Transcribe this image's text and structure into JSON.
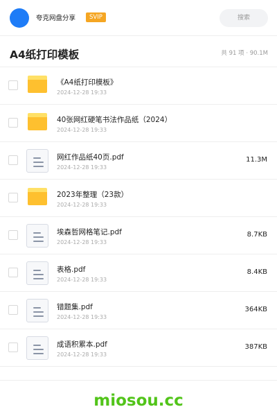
{
  "header": {
    "username": "夸克网盘分享",
    "badge": "SVIP",
    "search_label": "搜索",
    "avatar_color": "#1e7cf7"
  },
  "folder": {
    "title": "A4纸打印模板",
    "summary": "共 91 项 · 90.1M"
  },
  "files": [
    {
      "type": "folder",
      "icon": "folder-icon",
      "name": "《A4纸打印模板》",
      "date": "2024-12-28 19:33",
      "size": ""
    },
    {
      "type": "folder",
      "icon": "folder-icon",
      "name": "40张网红硬笔书法作品纸（2024）",
      "date": "2024-12-28 19:33",
      "size": ""
    },
    {
      "type": "file",
      "icon": "document-icon",
      "name": "网红作品纸40页.pdf",
      "date": "2024-12-28 19:33",
      "size": "11.3M"
    },
    {
      "type": "folder",
      "icon": "folder-icon",
      "name": "2023年整理（23款）",
      "date": "2024-12-28 19:33",
      "size": ""
    },
    {
      "type": "file",
      "icon": "document-icon",
      "name": "埃森哲网格笔记.pdf",
      "date": "2024-12-28 19:33",
      "size": "8.7KB"
    },
    {
      "type": "file",
      "icon": "document-icon",
      "name": "表格.pdf",
      "date": "2024-12-28 19:33",
      "size": "8.4KB"
    },
    {
      "type": "file",
      "icon": "document-icon",
      "name": "错题集.pdf",
      "date": "2024-12-28 19:33",
      "size": "364KB"
    },
    {
      "type": "file",
      "icon": "document-icon",
      "name": "成语积累本.pdf",
      "date": "2024-12-28 19:33",
      "size": "387KB"
    }
  ],
  "footer": {
    "watermark": "miosou.cc",
    "watermark_color": "#52c41a"
  }
}
